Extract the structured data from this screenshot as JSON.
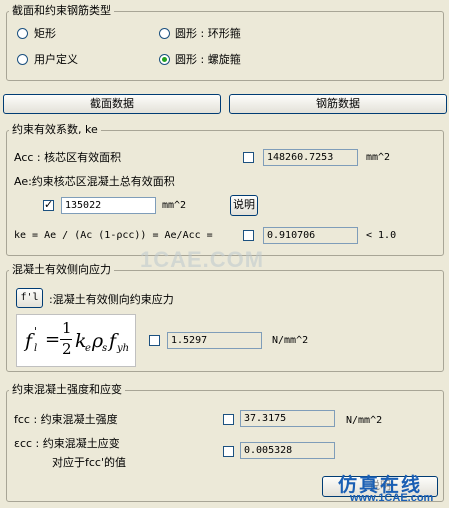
{
  "section_type": {
    "title": "截面和约束钢筋类型",
    "options": [
      {
        "label": "矩形",
        "selected": false
      },
      {
        "label": "圆形 : 环形箍",
        "selected": false
      },
      {
        "label": "用户定义",
        "selected": false
      },
      {
        "label": "圆形 : 螺旋箍",
        "selected": true
      }
    ]
  },
  "buttons": {
    "section_data": "截面数据",
    "rebar_data": "钢筋数据",
    "explain1": "说明",
    "explain2": "说明",
    "f1": "f'l"
  },
  "ke_group": {
    "title": "约束有效系数, ke",
    "acc_label": "Acc : 核芯区有效面积",
    "acc_value": "148260.7253",
    "acc_unit": "mm^2",
    "ae_label": "Ae:约束核芯区混凝土总有效面积",
    "ae_value": "135022",
    "ae_unit": "mm^2",
    "ke_formula": "ke = Ae / (Ac (1-ρcc)) = Ae/Acc =",
    "ke_value": "0.910706",
    "ke_limit": "< 1.0"
  },
  "lateral_group": {
    "title": "混凝土有效侧向应力",
    "desc": ":混凝土有效侧向约束应力",
    "value": "1.5297",
    "unit": "N/mm^2",
    "formula_parts": {
      "lhs": "f",
      "lhs_sub": "l",
      "lhs_sup": "'",
      "eq": "=",
      "num": "1",
      "den": "2",
      "k": "k",
      "k_sub": "e",
      "rho": "ρ",
      "rho_sub": "s",
      "fy": "f",
      "fy_sub": "yh"
    }
  },
  "strength_group": {
    "title": "约束混凝土强度和应变",
    "fcc_label": "fcc : 约束混凝土强度",
    "fcc_value": "37.3175",
    "fcc_unit": "N/mm^2",
    "ecc_label": "εcc : 约束混凝土应变",
    "ecc_label2": "对应于fcc'的值",
    "ecc_value": "0.005328"
  },
  "watermark": {
    "center": "1CAE.COM",
    "corner_cn": "仿真在线",
    "corner_url": "www.1CAE.com"
  },
  "colors": {
    "bg": "#ece9d8",
    "border": "#a8a596",
    "radio_dot": "#21a121",
    "watermark_blue": "#1a5fb4"
  }
}
